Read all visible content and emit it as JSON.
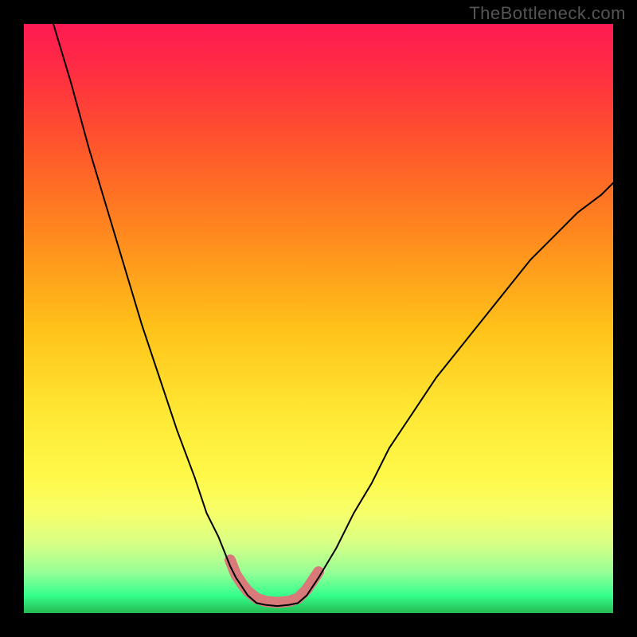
{
  "watermark": "TheBottleneck.com",
  "chart_data": {
    "type": "line",
    "title": "",
    "xlabel": "",
    "ylabel": "",
    "xlim": [
      0,
      1
    ],
    "ylim": [
      0,
      100
    ],
    "series": [
      {
        "name": "left-branch",
        "x": [
          0.05,
          0.08,
          0.11,
          0.14,
          0.17,
          0.2,
          0.23,
          0.26,
          0.29,
          0.31,
          0.33,
          0.35,
          0.36,
          0.37,
          0.38,
          0.395
        ],
        "values": [
          100,
          90,
          79,
          69,
          59,
          49,
          40,
          31,
          23,
          17,
          13,
          8,
          6,
          4.5,
          3,
          1.7
        ]
      },
      {
        "name": "flat-bottom",
        "x": [
          0.395,
          0.41,
          0.43,
          0.45,
          0.465
        ],
        "values": [
          1.7,
          1.4,
          1.2,
          1.4,
          1.7
        ]
      },
      {
        "name": "right-branch",
        "x": [
          0.465,
          0.48,
          0.5,
          0.53,
          0.56,
          0.59,
          0.62,
          0.66,
          0.7,
          0.74,
          0.78,
          0.82,
          0.86,
          0.9,
          0.94,
          0.98,
          1.0
        ],
        "values": [
          1.7,
          3,
          6,
          11,
          17,
          22,
          28,
          34,
          40,
          45,
          50,
          55,
          60,
          64,
          68,
          71,
          73
        ]
      }
    ],
    "annotations": [
      {
        "name": "valley-highlight",
        "x": [
          0.35,
          0.36,
          0.37,
          0.38,
          0.395,
          0.41,
          0.43,
          0.45,
          0.465,
          0.48,
          0.5
        ],
        "values": [
          9.0,
          6.5,
          5.0,
          3.7,
          2.5,
          2.0,
          1.8,
          2.0,
          2.5,
          4.0,
          7.0
        ],
        "style": "thick-pink"
      }
    ]
  }
}
